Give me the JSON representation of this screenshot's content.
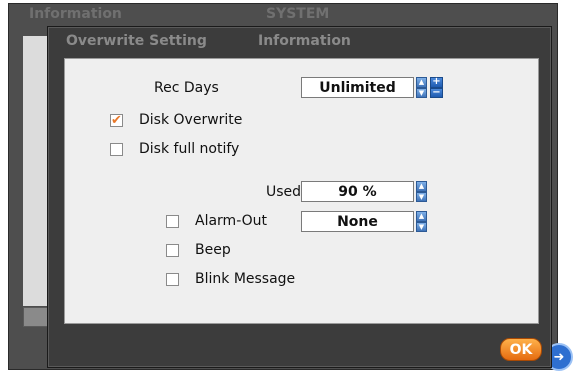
{
  "background_window": {
    "tabs": [
      "Information",
      "SYSTEM"
    ],
    "nav_icon": "right-arrow-icon"
  },
  "dialog": {
    "tabs": [
      "Overwrite Setting",
      "Information"
    ],
    "rec_days": {
      "label": "Rec Days",
      "value": "Unlimited"
    },
    "disk_overwrite": {
      "label": "Disk Overwrite",
      "checked": true
    },
    "disk_full_notify": {
      "label": "Disk full notify",
      "checked": false
    },
    "used": {
      "label": "Used",
      "value": "90 %"
    },
    "alarm_out": {
      "label": "Alarm-Out",
      "checked": false,
      "value": "None"
    },
    "beep": {
      "label": "Beep",
      "checked": false
    },
    "blink_message": {
      "label": "Blink Message",
      "checked": false
    },
    "ok_label": "OK"
  },
  "colors": {
    "accent_orange": "#e8782a",
    "spinner_blue": "#3f73b8",
    "dialog_bg": "#3c3c3c",
    "content_bg": "#efefef"
  }
}
